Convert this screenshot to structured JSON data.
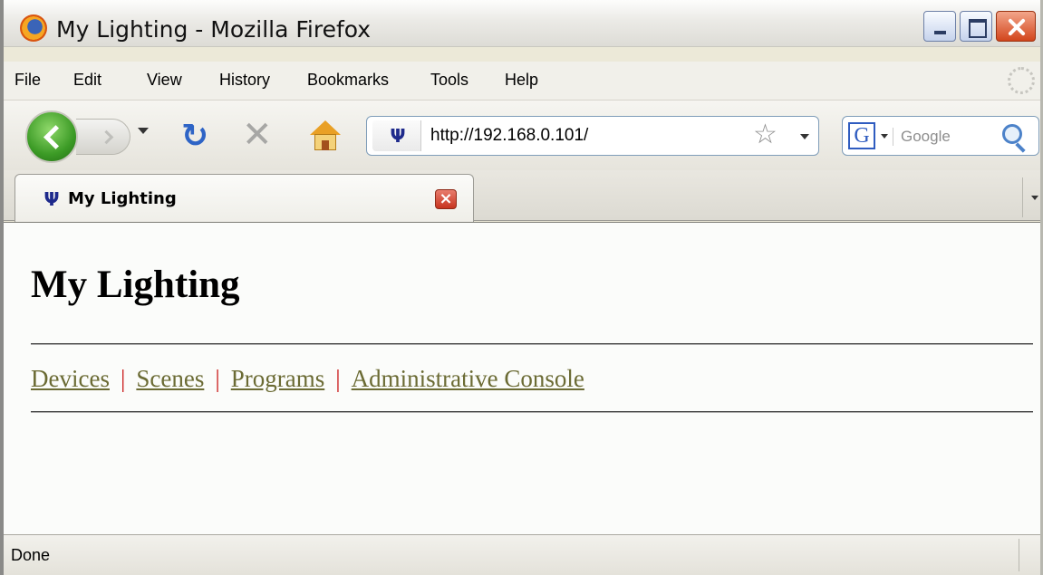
{
  "window": {
    "title": "My Lighting - Mozilla Firefox"
  },
  "menu": {
    "items": [
      "File",
      "Edit",
      "View",
      "History",
      "Bookmarks",
      "Tools",
      "Help"
    ]
  },
  "toolbar": {
    "url": "http://192.168.0.101/",
    "search_placeholder": "Google",
    "search_engine_glyph": "G"
  },
  "tab": {
    "label": "My Lighting",
    "close_glyph": "×"
  },
  "page": {
    "heading": "My Lighting",
    "links": [
      {
        "label": "Devices"
      },
      {
        "label": "Scenes"
      },
      {
        "label": "Programs"
      },
      {
        "label": "Administrative Console"
      }
    ],
    "separator": "|",
    "link_color": "#6b6b34",
    "separator_color": "#cc2222"
  },
  "status": {
    "text": "Done"
  },
  "icons": {
    "favicon_glyph": "Ψ"
  }
}
